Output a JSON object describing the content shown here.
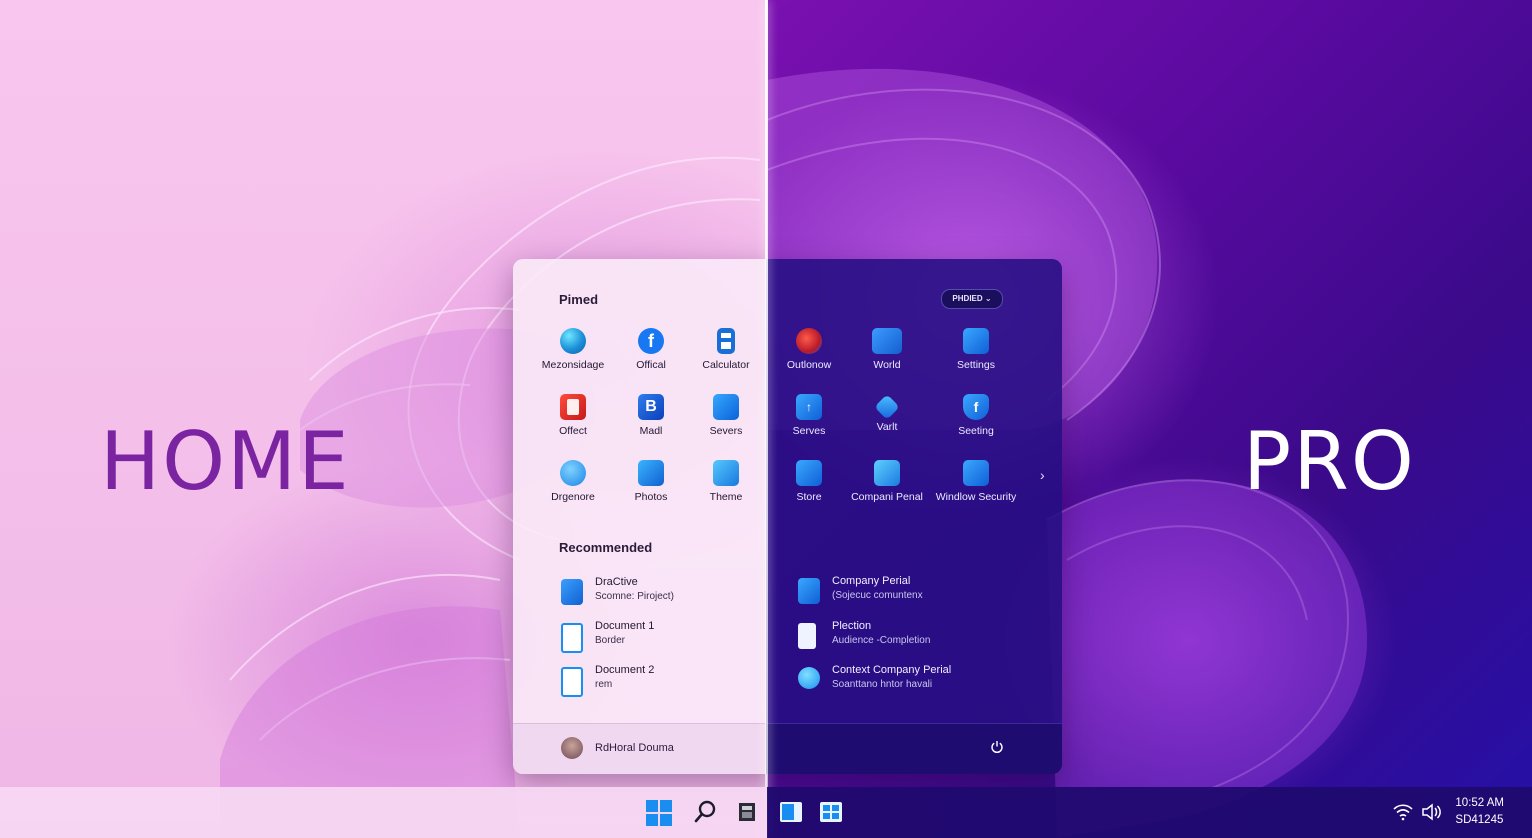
{
  "editions": {
    "left": "HOME",
    "right": "PRO"
  },
  "start_menu": {
    "pinned_title": "Pimed",
    "pinned_pill": "PHDIED ⌄",
    "pinned_light": [
      {
        "label": "Mezonsidage",
        "icon": "edge-icon"
      },
      {
        "label": "Offical",
        "icon": "facebook-icon"
      },
      {
        "label": "Calculator",
        "icon": "calculator-icon"
      },
      {
        "label": "Offect",
        "icon": "office-icon"
      },
      {
        "label": "Madl",
        "icon": "mail-icon"
      },
      {
        "label": "Severs",
        "icon": "severs-icon"
      },
      {
        "label": "Drgenore",
        "icon": "maps-pin-icon"
      },
      {
        "label": "Photos",
        "icon": "photos-icon"
      },
      {
        "label": "Theme",
        "icon": "theme-icon"
      }
    ],
    "pinned_dark": [
      {
        "label": "Outlonow",
        "icon": "outlook-icon"
      },
      {
        "label": "World",
        "icon": "word-icon"
      },
      {
        "label": "Settings",
        "icon": "settings-icon"
      },
      {
        "label": "Serves",
        "icon": "serves-icon"
      },
      {
        "label": "Varlt",
        "icon": "vault-icon"
      },
      {
        "label": "Seeting",
        "icon": "shield-f-icon"
      },
      {
        "label": "Store",
        "icon": "store-icon"
      },
      {
        "label": "Compani Penal",
        "icon": "control-panel-icon"
      },
      {
        "label": "Windlow Security",
        "icon": "windows-security-icon"
      }
    ],
    "recommended_title": "Recommended",
    "recommended_light": [
      {
        "title": "DraCtive",
        "subtitle": "Scomne: Piroject)",
        "icon": "folder-icon"
      },
      {
        "title": "Document 1",
        "subtitle": "Border",
        "icon": "document-icon"
      },
      {
        "title": "Document 2",
        "subtitle": "rem",
        "icon": "document-icon"
      }
    ],
    "recommended_dark": [
      {
        "title": "Company Perial",
        "subtitle": "(Sojecuc comuntenx",
        "icon": "company-folder-icon"
      },
      {
        "title": "Plection",
        "subtitle": "Audience -Completion",
        "icon": "spreadsheet-icon"
      },
      {
        "title": "Context Company Perial",
        "subtitle": "Soanttano hntor havali",
        "icon": "edge-doc-icon"
      }
    ],
    "user_name": "RdHoral Douma"
  },
  "taskbar": {
    "time": "10:52 AM",
    "date": "SD41245"
  },
  "colors": {
    "home_text": "#7a24a2",
    "pro_text": "#ffffff",
    "accent_blue": "#1a8ef0"
  }
}
